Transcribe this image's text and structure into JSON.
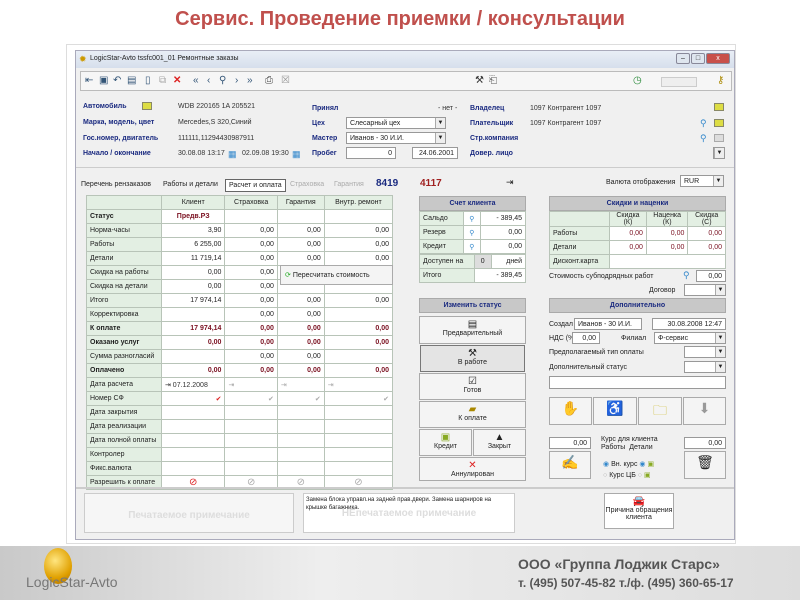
{
  "slide_title": "Сервис. Проведение приемки / консультации",
  "window": {
    "title": "LogicStar-Avto  tssfc001_01  Ремонтные заказы",
    "min": "–",
    "max": "□",
    "close": "x"
  },
  "header": {
    "car_label": "Автомобиль",
    "car_value": "WDB 220165 1A 205521",
    "model_label": "Марка, модель, цвет",
    "model_value": "Mercedes,S 320,Синий",
    "plate_label": "Гос.номер, двигатель",
    "plate_value": "111111,11294430987911",
    "dates_label": "Начало / окончание",
    "start": "30.08.08 13:17",
    "end": "02.09.08 19:30",
    "accepted_label": "Принял",
    "accepted_value": "- нет -",
    "shop_label": "Цех",
    "shop_value": "Слесарный цех",
    "master_label": "Мастер",
    "master_value": "Иванов - 30 И.И.",
    "mileage_label": "Пробег",
    "mileage_value": "0",
    "mileage_date": "24.06.2001",
    "owner_label": "Владелец",
    "owner_value": "1097 Контрагент 1097",
    "payer_label": "Плательщик",
    "payer_value": "1097 Контрагент 1097",
    "insurer_label": "Стр.компания",
    "trustee_label": "Довер. лицо"
  },
  "tabs": [
    "Перечень рензаказов",
    "Работы и детали",
    "Расчет и оплата",
    "Страховка",
    "Гарантия"
  ],
  "order_no": "8419",
  "order_no2": "4117",
  "currency_label": "Валюта отображения",
  "currency_value": "RUR",
  "calc_table": {
    "columns": [
      "",
      "Клиент",
      "Страховка",
      "Гарантия",
      "Внутр. ремонт"
    ],
    "rows": [
      [
        "Статус",
        "Предв.РЗ",
        "",
        "",
        ""
      ],
      [
        "Норма-часы",
        "3,90",
        "0,00",
        "0,00",
        "0,00"
      ],
      [
        "Работы",
        "6 255,00",
        "0,00",
        "0,00",
        "0,00"
      ],
      [
        "Детали",
        "11 719,14",
        "0,00",
        "0,00",
        "0,00"
      ],
      [
        "Скидка на работы",
        "0,00",
        "0,00",
        "",
        ""
      ],
      [
        "Скидка на детали",
        "0,00",
        "0,00",
        "",
        ""
      ],
      [
        "Итого",
        "17 974,14",
        "0,00",
        "0,00",
        "0,00"
      ],
      [
        "Корректировка",
        "",
        "0,00",
        "0,00",
        ""
      ],
      [
        "К оплате",
        "17 974,14",
        "0,00",
        "0,00",
        "0,00"
      ],
      [
        "Оказано услуг",
        "0,00",
        "0,00",
        "0,00",
        "0,00"
      ],
      [
        "Сумма разногласий",
        "",
        "0,00",
        "0,00",
        ""
      ],
      [
        "Оплачено",
        "0,00",
        "0,00",
        "0,00",
        "0,00"
      ],
      [
        "Дата расчета",
        "⇥ 07.12.2008",
        "⇥",
        "⇥",
        "⇥"
      ],
      [
        "Номер СФ",
        "✔",
        "✔",
        "✔",
        "✔"
      ],
      [
        "Дата закрытия",
        "",
        "",
        "",
        ""
      ],
      [
        "Дата реализации",
        "",
        "",
        "",
        ""
      ],
      [
        "Дата полной оплаты",
        "",
        "",
        "",
        ""
      ],
      [
        "Контролер",
        "",
        "",
        "",
        ""
      ],
      [
        "Фикс.валюта",
        "",
        "",
        "",
        ""
      ],
      [
        "Разрешить к оплате",
        "⊘",
        "⊘",
        "⊘",
        "⊘"
      ]
    ],
    "bold_rows": [
      0,
      8,
      9,
      11
    ]
  },
  "recalc_button": "Пересчитать стоимость",
  "account": {
    "title": "Счет клиента",
    "saldo_label": "Сальдо",
    "saldo": "- 389,45",
    "reserve_label": "Резерв",
    "reserve": "0,00",
    "credit_label": "Кредит",
    "credit": "0,00",
    "avail_label": "Доступен на",
    "avail": "0",
    "days": "дней",
    "total_label": "Итого",
    "total": "- 389,45"
  },
  "status": {
    "title": "Изменить статус",
    "prelim": "Предварительный",
    "inwork": "В работе",
    "ready": "Готов",
    "topay": "К оплате",
    "credit": "Кредит",
    "closed": "Закрыт",
    "cancel": "Аннулирован"
  },
  "discounts": {
    "title": "Скидки и наценки",
    "cols": [
      "Скидка (К)",
      "Наценка (К)",
      "Скидка (С)"
    ],
    "works_label": "Работы",
    "works": [
      "0,00",
      "0,00",
      "0,00"
    ],
    "parts_label": "Детали",
    "parts": [
      "0,00",
      "0,00",
      "0,00"
    ],
    "card_label": "Дисконт.карта",
    "subcontract_label": "Стоимость субподрядных работ",
    "subcontract": "0,00",
    "contract_label": "Договор"
  },
  "extra": {
    "title": "Дополнительно",
    "created_label": "Создал",
    "created_by": "Иванов - 30 И.И.",
    "created_at": "30.08.2008 12:47",
    "vat_label": "НДС (%)",
    "vat": "0,00",
    "branch_label": "Филиал",
    "branch": "Ф-сервис",
    "paytype_label": "Предполагаемый тип оплаты",
    "addstatus_label": "Дополнительный статус"
  },
  "rate": {
    "left": "0,00",
    "right": "0,00",
    "label": "Курс для клиента",
    "works": "Работы",
    "parts": "Детали",
    "internal": "Вн. курс",
    "cb": "Курс ЦБ"
  },
  "notes": {
    "printed": "Печатаемое примечание",
    "unprinted": "НЕпечатаемое примечание",
    "unprinted_text": "Замена блока управл.на задней прав.двери. Замена шарниров на крышке багажника.",
    "reason": "Причина обращения клиента"
  },
  "footer": {
    "logo": "LogicStar-Avto",
    "company": "ООО «Группа Лоджик Старс»",
    "phones": "т. (495) 507-45-82   т./ф. (495) 360-65-17"
  }
}
